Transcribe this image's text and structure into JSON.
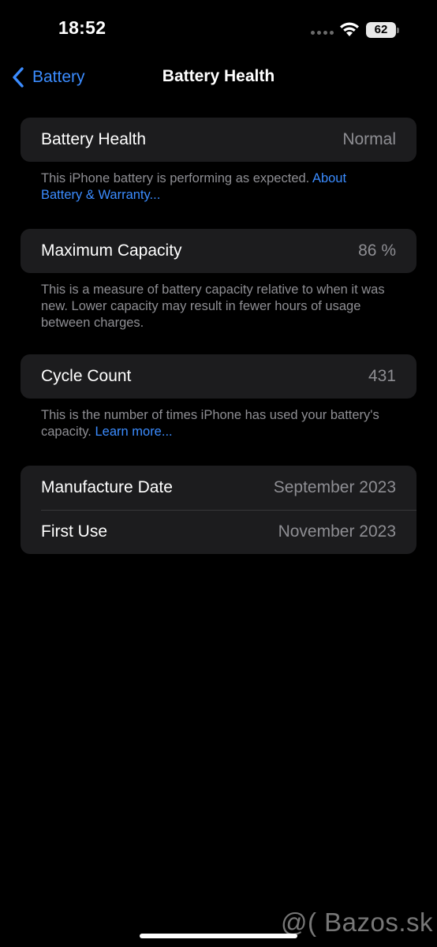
{
  "status_bar": {
    "time": "18:52",
    "battery_level": "62",
    "icons": [
      "cellular-signal-icon",
      "wifi-icon",
      "battery-icon"
    ]
  },
  "nav": {
    "back_label": "Battery",
    "title": "Battery Health"
  },
  "battery_health": {
    "label": "Battery Health",
    "value": "Normal",
    "footnote_text": "This iPhone battery is performing as expected. ",
    "footnote_link": "About Battery & Warranty..."
  },
  "maximum_capacity": {
    "label": "Maximum Capacity",
    "value": "86 %",
    "footnote_text": "This is a measure of battery capacity relative to when it was new. Lower capacity may result in fewer hours of usage between charges."
  },
  "cycle_count": {
    "label": "Cycle Count",
    "value": "431",
    "footnote_text": "This is the number of times iPhone has used your battery's capacity. ",
    "footnote_link": "Learn more..."
  },
  "dates": {
    "manufacture_label": "Manufacture Date",
    "manufacture_value": "September 2023",
    "first_use_label": "First Use",
    "first_use_value": "November 2023"
  },
  "watermark": "@( Bazos.sk",
  "colors": {
    "background": "#000000",
    "cell": "#1c1c1e",
    "accent": "#3b8cff",
    "secondary_text": "#8e8e93"
  }
}
